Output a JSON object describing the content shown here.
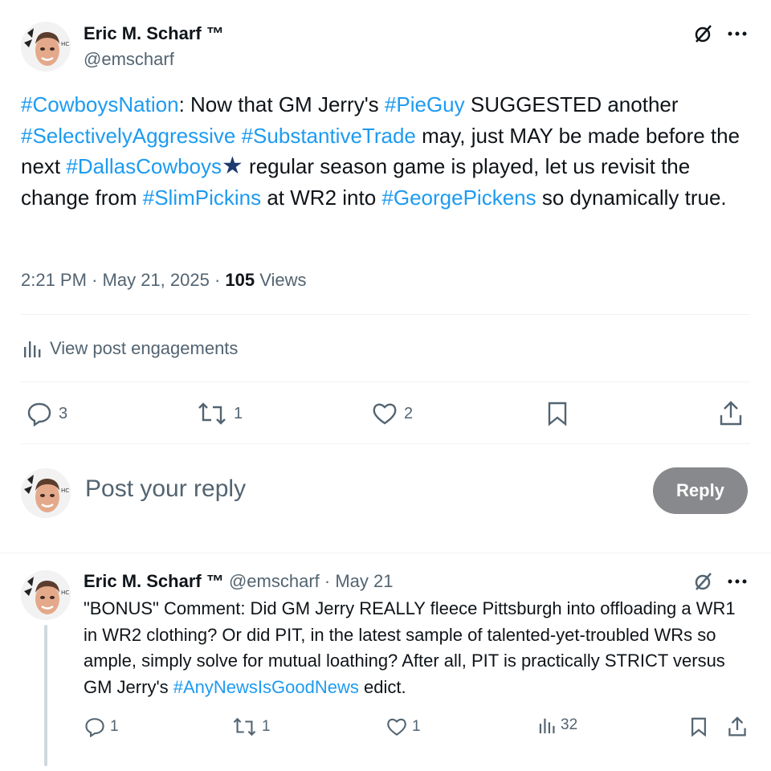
{
  "main_tweet": {
    "author_name": "Eric M. Scharf ™",
    "author_handle": "@emscharf",
    "text_segments": [
      {
        "type": "hashtag",
        "text": "#CowboysNation"
      },
      {
        "type": "text",
        "text": ": Now that GM Jerry's "
      },
      {
        "type": "hashtag",
        "text": "#PieGuy"
      },
      {
        "type": "text",
        "text": " SUGGESTED another "
      },
      {
        "type": "hashtag",
        "text": "#SelectivelyAggressive"
      },
      {
        "type": "text",
        "text": " "
      },
      {
        "type": "hashtag",
        "text": "#SubstantiveTrade"
      },
      {
        "type": "text",
        "text": " may, just MAY be made before the next "
      },
      {
        "type": "hashtag",
        "text": "#DallasCowboys"
      },
      {
        "type": "emoji",
        "text": "★"
      },
      {
        "type": "text",
        "text": " regular season game is played, let us revisit the change from "
      },
      {
        "type": "hashtag",
        "text": "#SlimPickins"
      },
      {
        "type": "text",
        "text": " at WR2 into "
      },
      {
        "type": "hashtag",
        "text": "#GeorgePickens"
      },
      {
        "type": "text",
        "text": " so dynamically true."
      }
    ],
    "time": "2:21 PM",
    "date": "May 21, 2025",
    "views_count": "105",
    "views_label": "Views",
    "engagements_label": "View post engagements",
    "replies": "3",
    "reposts": "1",
    "likes": "2"
  },
  "reply_box": {
    "placeholder": "Post your reply",
    "button_label": "Reply"
  },
  "reply_tweet": {
    "author_name": "Eric M. Scharf ™",
    "author_handle": "@emscharf",
    "separator": "·",
    "date": "May 21",
    "text_segments": [
      {
        "type": "text",
        "text": "\"BONUS\" Comment: Did GM Jerry REALLY fleece Pittsburgh into offloading a WR1 in WR2 clothing? Or did PIT, in the latest sample of talented-yet-troubled WRs so ample, simply solve for mutual loathing? After all, PIT is practically STRICT versus GM Jerry's "
      },
      {
        "type": "hashtag",
        "text": "#AnyNewsIsGoodNews"
      },
      {
        "type": "text",
        "text": " edict."
      }
    ],
    "replies": "1",
    "reposts": "1",
    "likes": "1",
    "views": "32"
  },
  "colors": {
    "link": "#1d9bf0",
    "muted": "#536471",
    "reply_button": "#87898c",
    "star": "#1e3a6e"
  }
}
